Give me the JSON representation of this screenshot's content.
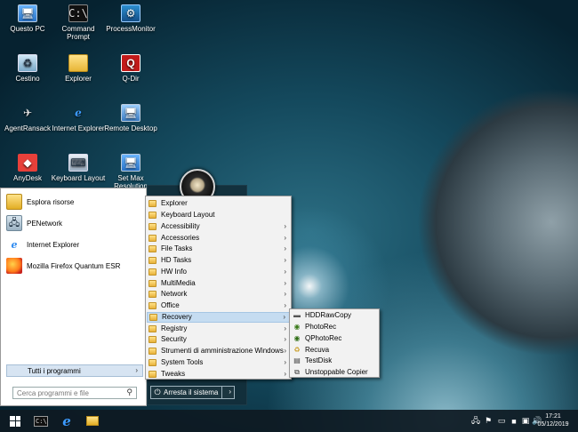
{
  "desktop": {
    "icons": [
      {
        "label": "Questo PC",
        "icon": "computer-icon",
        "glyph": "🖥"
      },
      {
        "label": "Command Prompt",
        "icon": "command-prompt-icon",
        "glyph": "C:\\"
      },
      {
        "label": "ProcessMonitor",
        "icon": "process-monitor-icon",
        "glyph": "⚙"
      },
      {
        "label": "Cestino",
        "icon": "recycle-bin-icon",
        "glyph": "♻"
      },
      {
        "label": "Explorer",
        "icon": "folder-icon",
        "glyph": ""
      },
      {
        "label": "Q-Dir",
        "icon": "q-dir-icon",
        "glyph": "Q"
      },
      {
        "label": "AgentRansack",
        "icon": "agent-ransack-icon",
        "glyph": "✈"
      },
      {
        "label": "Internet Explorer",
        "icon": "internet-explorer-icon",
        "glyph": "e"
      },
      {
        "label": "Remote Desktop",
        "icon": "remote-desktop-icon",
        "glyph": "🖥"
      },
      {
        "label": "AnyDesk",
        "icon": "anydesk-icon",
        "glyph": "◆"
      },
      {
        "label": "Keyboard Layout",
        "icon": "keyboard-icon",
        "glyph": "⌨"
      },
      {
        "label": "Set Max Resolution",
        "icon": "resolution-icon",
        "glyph": "🖥"
      }
    ]
  },
  "start_menu": {
    "pinned": [
      {
        "label": "Esplora risorse",
        "icon": "folder-icon",
        "glyph": ""
      },
      {
        "label": "PENetwork",
        "icon": "network-icon",
        "glyph": "🖧"
      },
      {
        "label": "Internet Explorer",
        "icon": "internet-explorer-icon",
        "glyph": "e"
      },
      {
        "label": "Mozilla Firefox Quantum ESR",
        "icon": "firefox-icon",
        "glyph": ""
      }
    ],
    "all_programs": "Tutti i programmi",
    "all_programs_arrow": "›",
    "search_placeholder": "Cerca programmi e file",
    "search_glyph": "⚲",
    "shutdown": {
      "label": "Arresta il sistema",
      "power_glyph": "⏻",
      "arrow": "›"
    }
  },
  "programs_menu": {
    "items": [
      {
        "label": "Explorer",
        "submenu": false,
        "icon": "folder-icon"
      },
      {
        "label": "Keyboard Layout",
        "submenu": false,
        "icon": "keyboard-icon"
      },
      {
        "label": "Accessibility",
        "submenu": true,
        "icon": "folder-icon"
      },
      {
        "label": "Accessories",
        "submenu": true,
        "icon": "folder-icon"
      },
      {
        "label": "File Tasks",
        "submenu": true,
        "icon": "folder-icon"
      },
      {
        "label": "HD Tasks",
        "submenu": true,
        "icon": "folder-icon"
      },
      {
        "label": "HW Info",
        "submenu": true,
        "icon": "folder-icon"
      },
      {
        "label": "MultiMedia",
        "submenu": true,
        "icon": "folder-icon"
      },
      {
        "label": "Network",
        "submenu": true,
        "icon": "folder-icon"
      },
      {
        "label": "Office",
        "submenu": true,
        "icon": "folder-icon"
      },
      {
        "label": "Recovery",
        "submenu": true,
        "icon": "folder-icon",
        "highlighted": true
      },
      {
        "label": "Registry",
        "submenu": true,
        "icon": "folder-icon"
      },
      {
        "label": "Security",
        "submenu": true,
        "icon": "folder-icon"
      },
      {
        "label": "Strumenti di amministrazione Windows",
        "submenu": true,
        "icon": "folder-icon"
      },
      {
        "label": "System Tools",
        "submenu": true,
        "icon": "folder-icon"
      },
      {
        "label": "Tweaks",
        "submenu": true,
        "icon": "folder-icon"
      }
    ],
    "submenu_arrow": "›"
  },
  "recovery_menu": {
    "items": [
      {
        "label": "HDDRawCopy",
        "icon": "hdd-raw-copy-icon",
        "glyph": "▬",
        "color": "#555555"
      },
      {
        "label": "PhotoRec",
        "icon": "photorec-icon",
        "glyph": "◉",
        "color": "#3a7a1a"
      },
      {
        "label": "QPhotoRec",
        "icon": "qphotorec-icon",
        "glyph": "◉",
        "color": "#2e6d14"
      },
      {
        "label": "Recuva",
        "icon": "recuva-icon",
        "glyph": "♻",
        "color": "#c89a1e"
      },
      {
        "label": "TestDisk",
        "icon": "testdisk-icon",
        "glyph": "▤",
        "color": "#444444"
      },
      {
        "label": "Unstoppable Copier",
        "icon": "unstoppable-copier-icon",
        "glyph": "⧉",
        "color": "#333333"
      }
    ]
  },
  "taskbar": {
    "clock_time": "17:21",
    "clock_date": "05/12/2019",
    "tray": [
      {
        "icon": "network-tray-icon",
        "glyph": "🖧"
      },
      {
        "icon": "security-tray-icon",
        "glyph": "⚑"
      },
      {
        "icon": "keyboard-tray-icon",
        "glyph": "▭"
      },
      {
        "icon": "display-tray-icon",
        "glyph": "■"
      },
      {
        "icon": "remote-tray-icon",
        "glyph": "▣"
      },
      {
        "icon": "volume-tray-icon",
        "glyph": "🔊"
      }
    ]
  }
}
